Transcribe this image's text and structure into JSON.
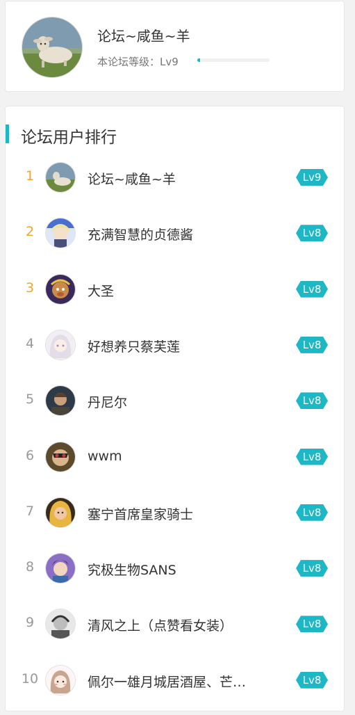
{
  "profile": {
    "name": "论坛~咸鱼~羊",
    "level_text": "本论坛等级：Lv9",
    "progress": 0.04
  },
  "ranking": {
    "title": "论坛用户排行",
    "rows": [
      {
        "rank": "1",
        "name": "论坛~咸鱼~羊",
        "level": "Lv9",
        "avatar": "sheep-avatar"
      },
      {
        "rank": "2",
        "name": "充满智慧的贞德酱",
        "level": "Lv8",
        "avatar": "anime-knight-avatar"
      },
      {
        "rank": "3",
        "name": "大圣",
        "level": "Lv8",
        "avatar": "monkey-king-avatar"
      },
      {
        "rank": "4",
        "name": "好想养只蔡芙莲",
        "level": "Lv8",
        "avatar": "anime-girl-avatar"
      },
      {
        "rank": "5",
        "name": "丹尼尔",
        "level": "Lv8",
        "avatar": "man-avatar"
      },
      {
        "rank": "6",
        "name": "wwm",
        "level": "Lv8",
        "avatar": "masked-avatar"
      },
      {
        "rank": "7",
        "name": "塞宁首席皇家骑士",
        "level": "Lv8",
        "avatar": "blonde-avatar"
      },
      {
        "rank": "8",
        "name": "究极生物SANS",
        "level": "Lv8",
        "avatar": "jojo-avatar"
      },
      {
        "rank": "9",
        "name": "清风之上（点赞看女装）",
        "level": "Lv8",
        "avatar": "sketch-avatar"
      },
      {
        "rank": "10",
        "name": "佩尔一雄月城居酒屋、芒…",
        "level": "Lv8",
        "avatar": "cartoon-girl-avatar"
      }
    ]
  },
  "colors": {
    "accent": "#1eb7c6",
    "rank_top": "#f5a623",
    "rank_other": "#999999"
  }
}
